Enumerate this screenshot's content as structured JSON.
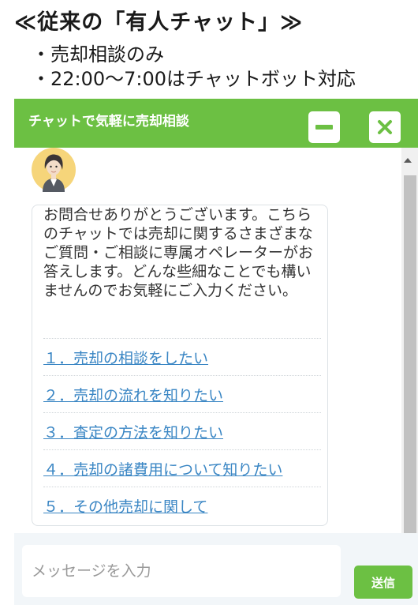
{
  "heading": "≪従来の「有人チャット」≫",
  "bullets": [
    "・売却相談のみ",
    "・22:00〜7:00はチャットボット対応"
  ],
  "chat": {
    "title": "チャットで気軽に売却相談",
    "minimize_icon": "minus-icon",
    "close_icon": "close-x-icon",
    "greeting": "お問合せありがとうございます。こちらのチャットでは売却に関するさまざまなご質問・ご相談に専属オペレーターがお答えします。どんな些細なことでも構いませんのでお気軽にご入力ください。",
    "options": [
      "１．売却の相談をしたい",
      "２．売却の流れを知りたい",
      "３．査定の方法を知りたい",
      "４．売却の諸費用について知りたい",
      "５．その他売却に関して"
    ],
    "input_placeholder": "メッセージを入力",
    "send_label": "送信",
    "colors": {
      "accent": "#6cc043",
      "link": "#3a86c4"
    }
  }
}
